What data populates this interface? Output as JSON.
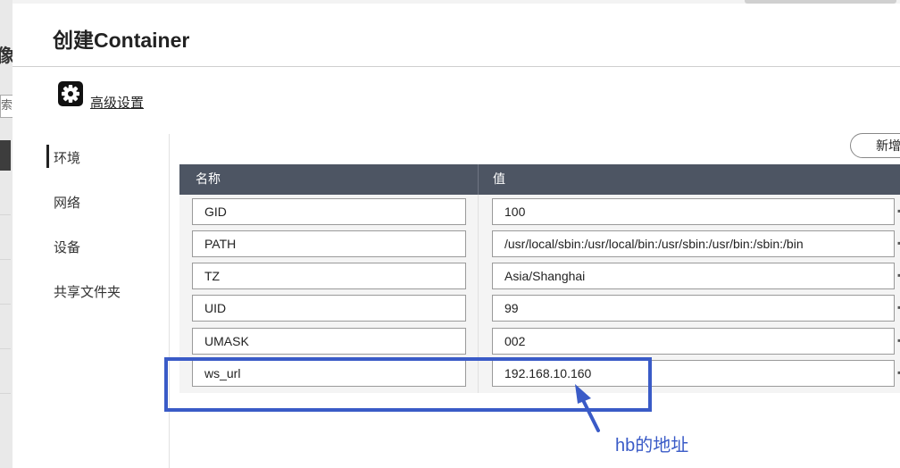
{
  "background": {
    "left_glyph": "像",
    "left_box_text": "索"
  },
  "dialog": {
    "title": "创建Container"
  },
  "advanced": {
    "icon": "gear-icon",
    "label": "高级设置"
  },
  "sidenav": {
    "items": [
      {
        "label": "环境",
        "active": true
      },
      {
        "label": "网络",
        "active": false
      },
      {
        "label": "设备",
        "active": false
      },
      {
        "label": "共享文件夹",
        "active": false
      }
    ]
  },
  "toolbar": {
    "add_label": "新增"
  },
  "env_table": {
    "headers": {
      "name": "名称",
      "value": "值"
    },
    "rows": [
      {
        "name": "GID",
        "value": "100"
      },
      {
        "name": "PATH",
        "value": "/usr/local/sbin:/usr/local/bin:/usr/sbin:/usr/bin:/sbin:/bin"
      },
      {
        "name": "TZ",
        "value": "Asia/Shanghai"
      },
      {
        "name": "UID",
        "value": "99"
      },
      {
        "name": "UMASK",
        "value": "002"
      },
      {
        "name": "ws_url",
        "value": "192.168.10.160"
      }
    ]
  },
  "annotation": {
    "text": "hb的地址",
    "color": "#3a5bc7"
  },
  "colors": {
    "table_header": "#4d5563",
    "annotation": "#3a5bc7"
  }
}
